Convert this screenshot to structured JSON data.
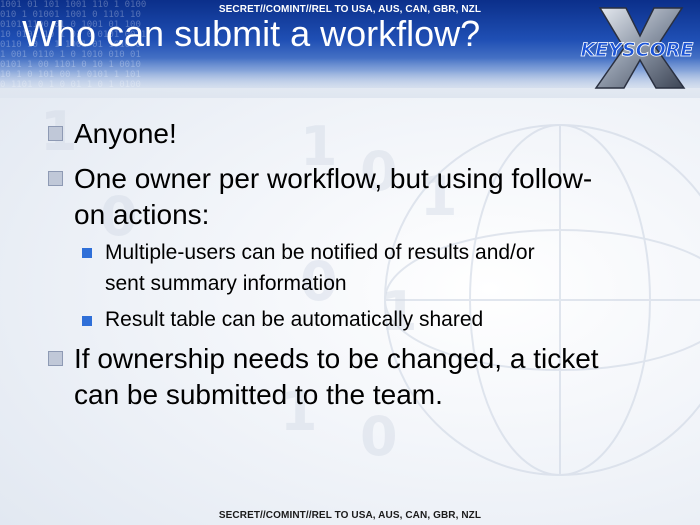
{
  "classification": {
    "top": "SECRET//COMINT//REL TO USA, AUS, CAN, GBR, NZL",
    "bottom": "SECRET//COMINT//REL TO USA, AUS, CAN, GBR, NZL"
  },
  "title": "Who can submit a workflow?",
  "logo": {
    "text": "KEYSCORE"
  },
  "bullets": [
    {
      "level": 1,
      "lines": [
        "Anyone!"
      ]
    },
    {
      "level": 1,
      "lines": [
        "One owner per workflow, but using follow-",
        "on actions:"
      ]
    },
    {
      "level": 2,
      "lines": [
        "Multiple-users can be notified of results and/or",
        "sent summary information"
      ]
    },
    {
      "level": 2,
      "lines": [
        "Result table can be automatically shared"
      ]
    },
    {
      "level": 1,
      "lines": [
        "If ownership needs to be changed, a ticket",
        "can be submitted to the team."
      ]
    }
  ],
  "colors": {
    "header_top": "#0b2f8a",
    "header_bottom": "#5d86cf",
    "sub_bullet": "#2f6fd8",
    "text": "#000000"
  }
}
